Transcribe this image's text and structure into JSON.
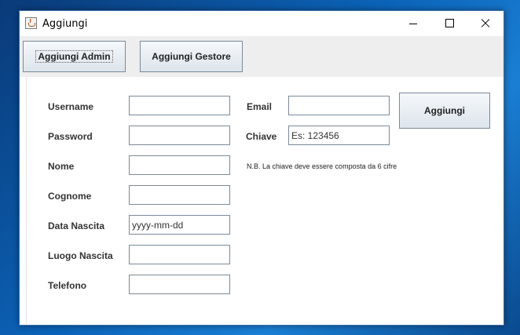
{
  "window": {
    "title": "Aggiungi"
  },
  "toolbar": {
    "admin_label": "Aggiungi Admin",
    "gestore_label": "Aggiungi Gestore"
  },
  "form": {
    "username_label": "Username",
    "username_value": "",
    "password_label": "Password",
    "password_value": "",
    "nome_label": "Nome",
    "nome_value": "",
    "cognome_label": "Cognome",
    "cognome_value": "",
    "data_nascita_label": "Data Nascita",
    "data_nascita_value": "yyyy-mm-dd",
    "luogo_nascita_label": "Luogo Nascita",
    "luogo_nascita_value": "",
    "telefono_label": "Telefono",
    "telefono_value": "",
    "email_label": "Email",
    "email_value": "",
    "chiave_label": "Chiave",
    "chiave_value": "Es: 123456",
    "note": "N.B. La chiave deve essere composta da 6 cifre",
    "add_label": "Aggiungi"
  },
  "icons": {
    "app": "java-cup-icon",
    "minimize": "minimize-icon",
    "maximize": "maximize-icon",
    "close": "close-icon"
  }
}
